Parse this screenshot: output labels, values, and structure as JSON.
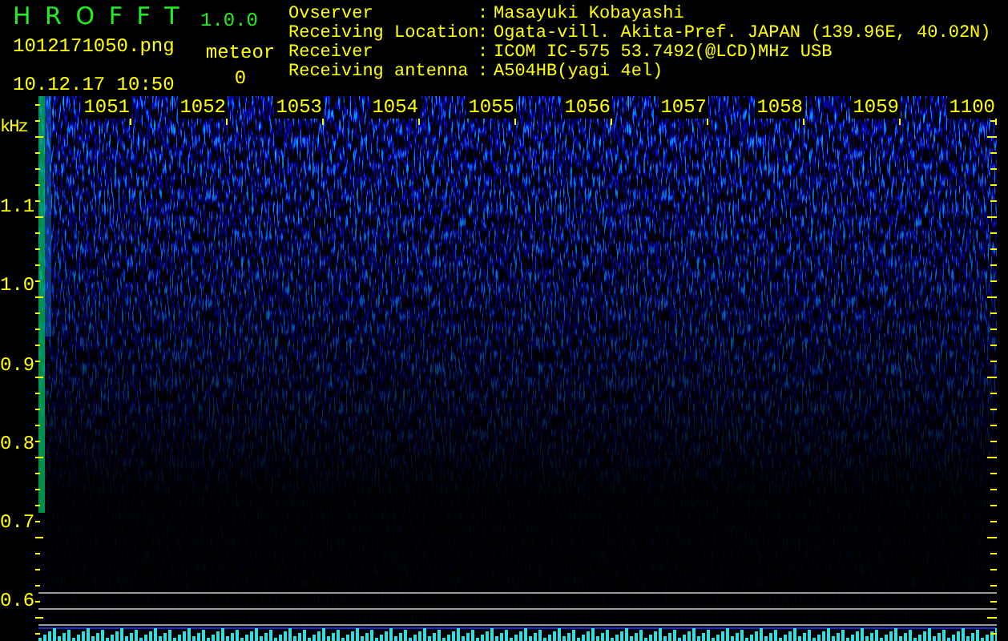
{
  "app": {
    "title": "H R O F F T",
    "version": "1.0.0",
    "file": "1012171050.png",
    "timestamp": "10.12.17 10:50",
    "meteor_label": "meteor",
    "meteor_count": "0"
  },
  "station": [
    {
      "label": "Ovserver",
      "separator": ":",
      "value": "Masayuki Kobayashi"
    },
    {
      "label": "Receiving Location",
      "separator": ":",
      "value": "Ogata-vill. Akita-Pref. JAPAN (139.96E, 40.02N)"
    },
    {
      "label": "Receiver",
      "separator": ":",
      "value": "ICOM IC-575 53.7492(@LCD)MHz USB"
    },
    {
      "label": "Receiving antenna",
      "separator": ":",
      "value": "A504HB(yagi 4el)"
    }
  ],
  "spectrogram": {
    "y_unit": "kHz",
    "y_labels": [
      "1.1",
      "1.0",
      "0.9",
      "0.8",
      "0.7",
      "0.6"
    ],
    "x_labels": [
      "1051",
      "1052",
      "1053",
      "1054",
      "1055",
      "1056",
      "1057",
      "1058",
      "1059",
      "1100"
    ]
  }
}
